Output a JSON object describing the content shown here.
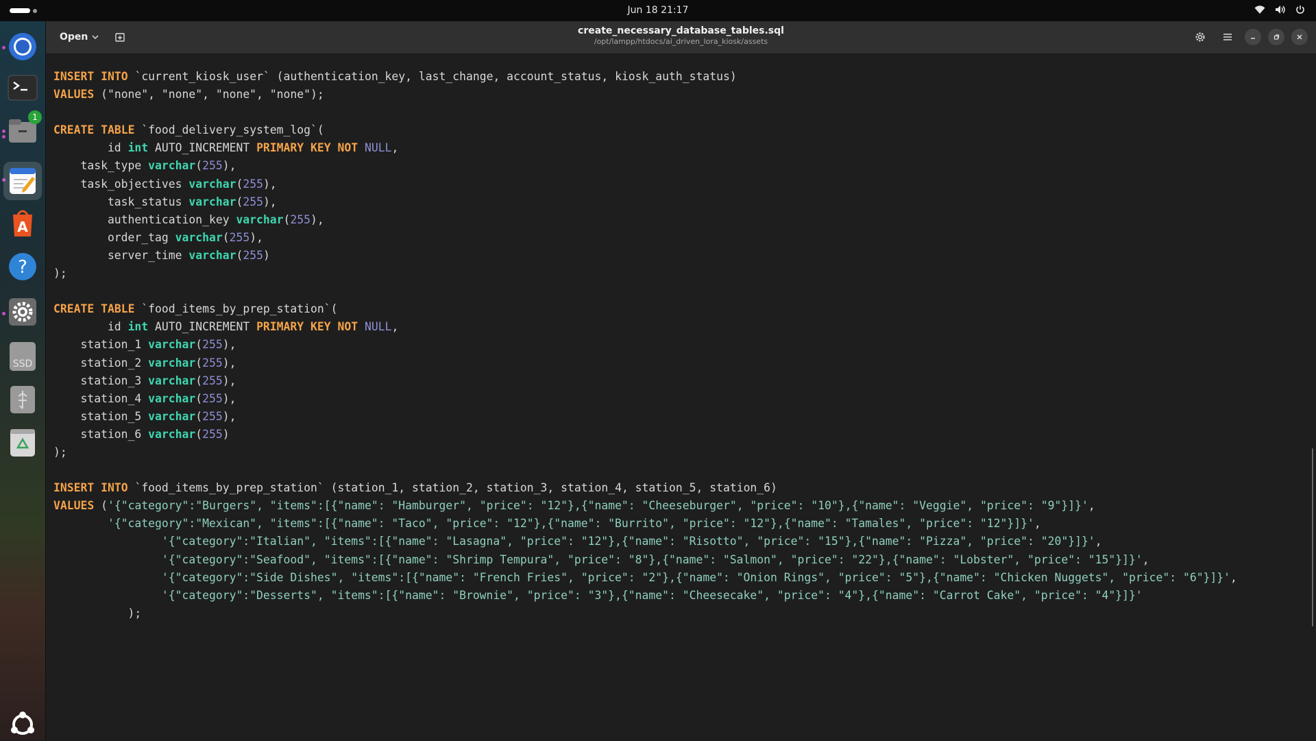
{
  "topbar": {
    "clock": "Jun 18  21:17"
  },
  "dock": {
    "items": [
      {
        "name": "Chromium"
      },
      {
        "name": "Terminal"
      },
      {
        "name": "Files",
        "badge": "1"
      },
      {
        "name": "Text Editor"
      },
      {
        "name": "App Center"
      },
      {
        "name": "Help"
      },
      {
        "name": "Settings"
      },
      {
        "name": "SSD",
        "label": "SSD"
      },
      {
        "name": "USB Drive"
      },
      {
        "name": "Trash"
      },
      {
        "name": "Show Apps"
      }
    ]
  },
  "header": {
    "open_label": "Open",
    "title": "create_necessary_database_tables.sql",
    "path": "/opt/lampp/htdocs/ai_driven_lora_kiosk/assets"
  },
  "editor": {
    "language": "SQL",
    "colors": {
      "keyword": "#f5a34a",
      "type": "#3fd6b0",
      "number": "#8f8fd8",
      "string": "#8fcfbe",
      "text": "#d8d8d8"
    },
    "lines": [
      "INSERT INTO `current_kiosk_user` (authentication_key, last_change, account_status, kiosk_auth_status)",
      "VALUES (\"none\", \"none\", \"none\", \"none\");",
      "",
      "CREATE TABLE `food_delivery_system_log`(",
      "        id int AUTO_INCREMENT PRIMARY KEY NOT NULL,",
      "    task_type varchar(255),",
      "    task_objectives varchar(255),",
      "        task_status varchar(255),",
      "        authentication_key varchar(255),",
      "        order_tag varchar(255),",
      "        server_time varchar(255)",
      ");",
      "",
      "CREATE TABLE `food_items_by_prep_station`(",
      "        id int AUTO_INCREMENT PRIMARY KEY NOT NULL,",
      "    station_1 varchar(255),",
      "    station_2 varchar(255),",
      "    station_3 varchar(255),",
      "    station_4 varchar(255),",
      "    station_5 varchar(255),",
      "    station_6 varchar(255)",
      ");",
      "",
      "INSERT INTO `food_items_by_prep_station` (station_1, station_2, station_3, station_4, station_5, station_6)",
      "VALUES ('{\"category\":\"Burgers\", \"items\":[{\"name\": \"Hamburger\", \"price\": \"12\"},{\"name\": \"Cheeseburger\", \"price\": \"10\"},{\"name\": \"Veggie\", \"price\": \"9\"}]}',",
      "        '{\"category\":\"Mexican\", \"items\":[{\"name\": \"Taco\", \"price\": \"12\"},{\"name\": \"Burrito\", \"price\": \"12\"},{\"name\": \"Tamales\", \"price\": \"12\"}]}',",
      "                '{\"category\":\"Italian\", \"items\":[{\"name\": \"Lasagna\", \"price\": \"12\"},{\"name\": \"Risotto\", \"price\": \"15\"},{\"name\": \"Pizza\", \"price\": \"20\"}]}',",
      "                '{\"category\":\"Seafood\", \"items\":[{\"name\": \"Shrimp Tempura\", \"price\": \"8\"},{\"name\": \"Salmon\", \"price\": \"22\"},{\"name\": \"Lobster\", \"price\": \"15\"}]}',",
      "                '{\"category\":\"Side Dishes\", \"items\":[{\"name\": \"French Fries\", \"price\": \"2\"},{\"name\": \"Onion Rings\", \"price\": \"5\"},{\"name\": \"Chicken Nuggets\", \"price\": \"6\"}]}',",
      "                '{\"category\":\"Desserts\", \"items\":[{\"name\": \"Brownie\", \"price\": \"3\"},{\"name\": \"Cheesecake\", \"price\": \"4\"},{\"name\": \"Carrot Cake\", \"price\": \"4\"}]}'",
      "           );"
    ]
  }
}
